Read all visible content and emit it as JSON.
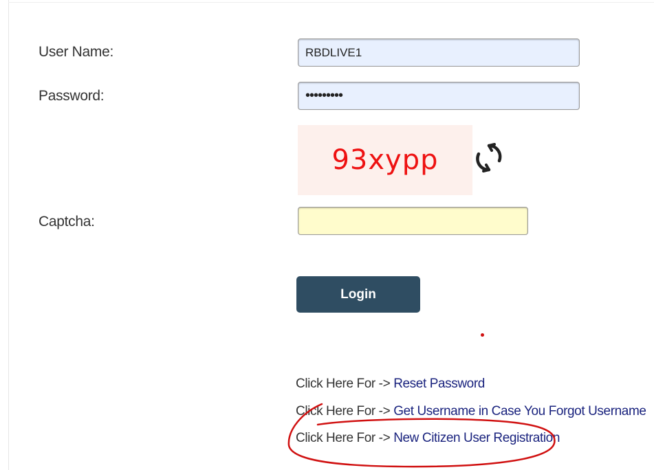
{
  "form": {
    "username_label": "User Name:",
    "username_value": "RBDLIVE1",
    "password_label": "Password:",
    "password_value": "RBDLIVE12",
    "captcha_image_text": "93xypp",
    "captcha_label": "Captcha:",
    "captcha_value": "",
    "login_label": "Login"
  },
  "links": [
    {
      "prefix": "Click Here For -> ",
      "label": "Reset Password"
    },
    {
      "prefix": "Click Here For -> ",
      "label": "Get Username in Case You Forgot Username"
    },
    {
      "prefix": "Click Here For -> ",
      "label": "New Citizen User Registration"
    }
  ],
  "icons": {
    "refresh": "refresh-icon"
  },
  "colors": {
    "login_button": "#2f4d62",
    "captcha_text": "#ee1111",
    "link": "#1a237e",
    "annotation": "#d01010"
  }
}
